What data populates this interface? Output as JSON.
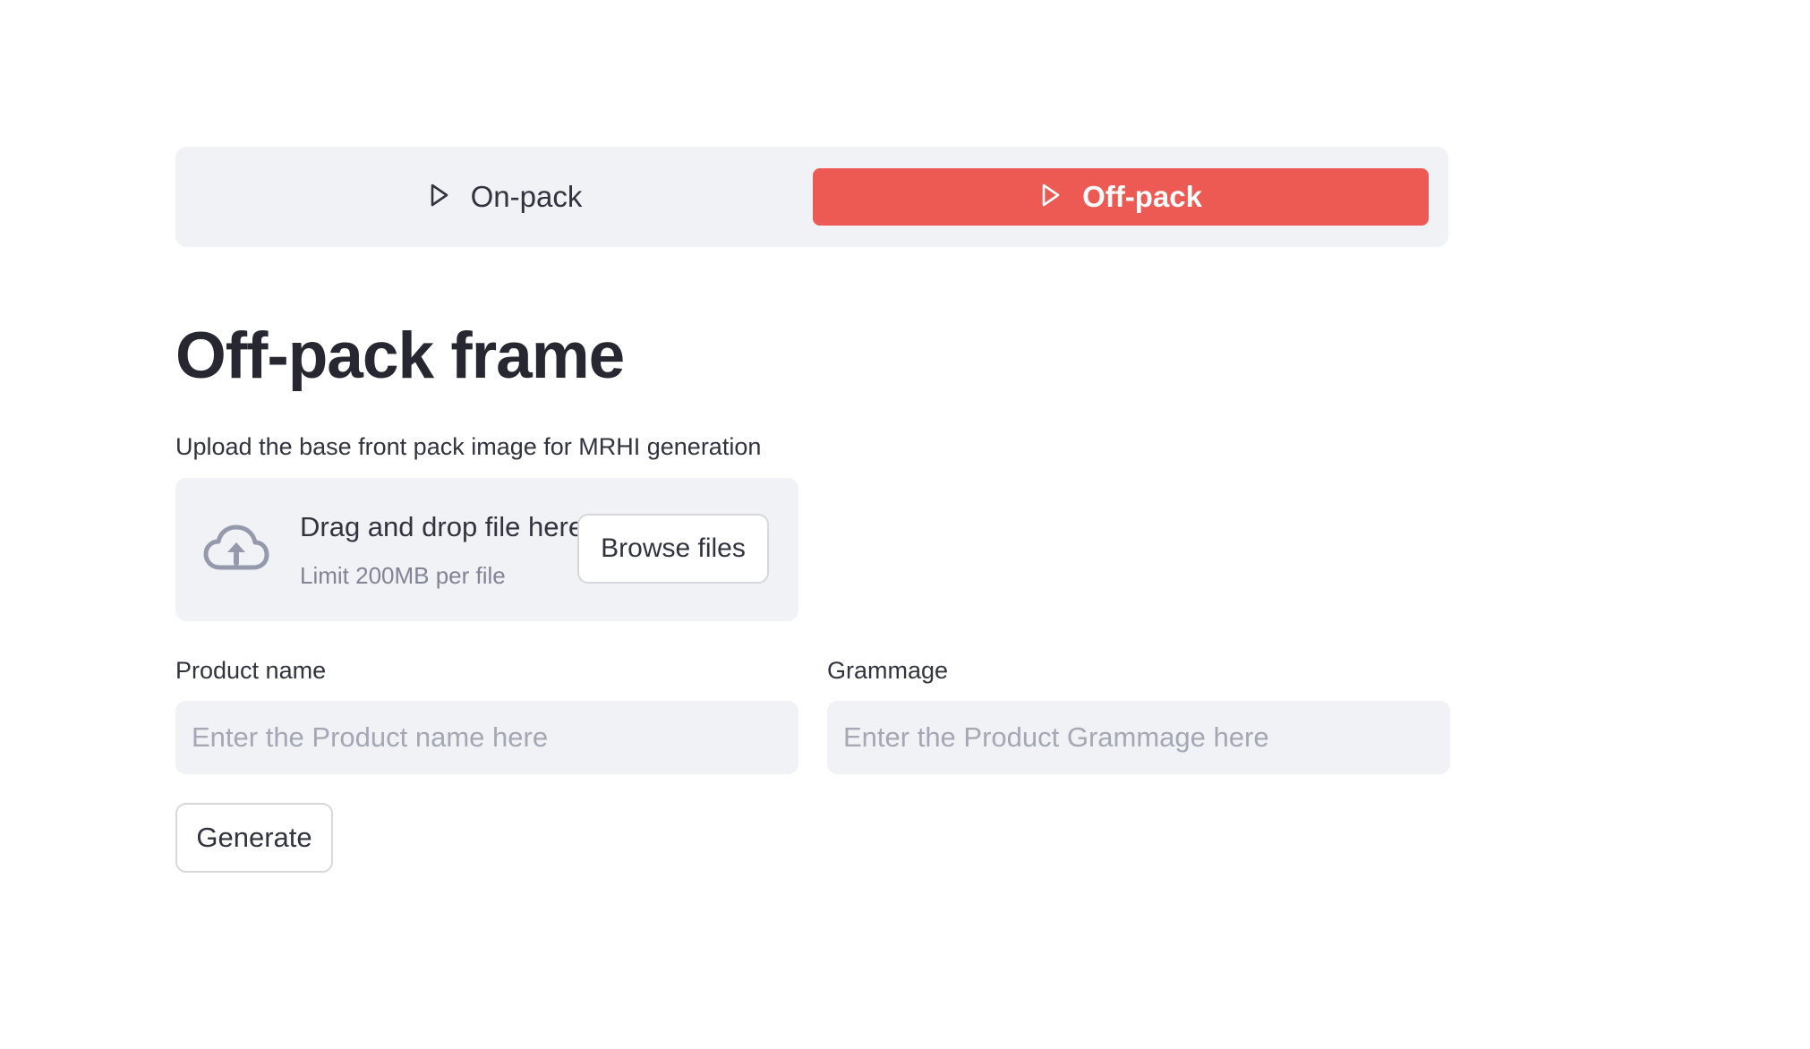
{
  "nav": {
    "items": [
      {
        "label": "On-pack",
        "icon": "play-outline-icon",
        "active": false
      },
      {
        "label": "Off-pack",
        "icon": "play-outline-icon",
        "active": true
      }
    ],
    "active_color": "#ed5a54"
  },
  "main": {
    "title": "Off-pack frame",
    "uploader": {
      "label": "Upload the base front pack image for MRHI generation",
      "drop_title": "Drag and drop file here",
      "drop_subtitle": "Limit 200MB per file",
      "browse_label": "Browse files",
      "icon": "cloud-upload-icon"
    },
    "fields": [
      {
        "label": "Product name",
        "placeholder": "Enter the Product name here",
        "value": ""
      },
      {
        "label": "Grammage",
        "placeholder": "Enter the Product Grammage here",
        "value": ""
      }
    ],
    "generate_label": "Generate"
  }
}
